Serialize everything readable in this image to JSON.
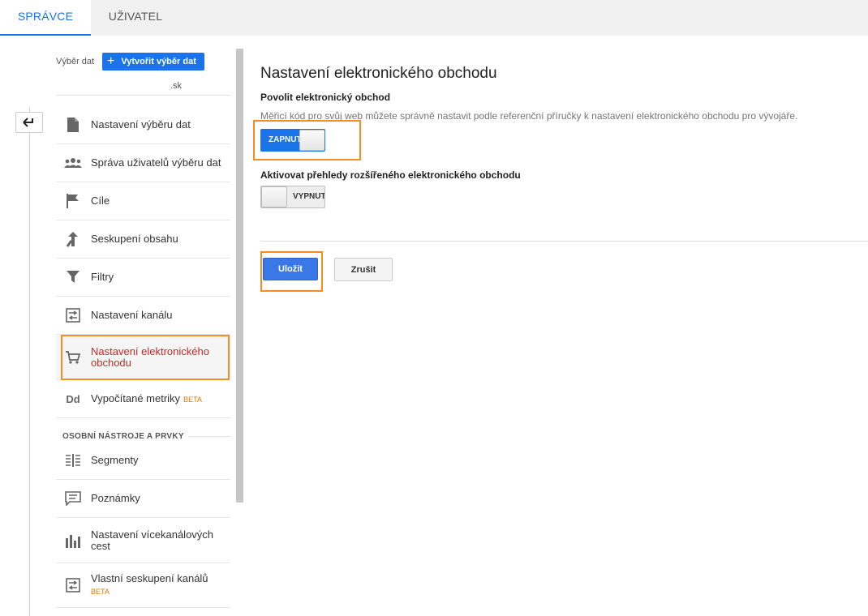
{
  "tabs": [
    {
      "label": "SPRÁVCE"
    },
    {
      "label": "UŽIVATEL"
    }
  ],
  "property": {
    "label": "Výběr dat",
    "create_button": "Vytvořit výběr dat",
    "domain": ".sk"
  },
  "sidebar": {
    "items": [
      {
        "label": "Nastavení výběru dat",
        "icon": "document-icon"
      },
      {
        "label": "Správa uživatelů výběru dat",
        "icon": "users-icon"
      },
      {
        "label": "Cíle",
        "icon": "flag-icon"
      },
      {
        "label": "Seskupení obsahu",
        "icon": "merge-icon"
      },
      {
        "label": "Filtry",
        "icon": "filter-icon"
      },
      {
        "label": "Nastavení kanálu",
        "icon": "channel-icon"
      },
      {
        "label": "Nastavení elektronického obchodu",
        "icon": "cart-icon",
        "active": true
      },
      {
        "label": "Vypočítané metriky",
        "badge": "BETA",
        "icon": "dd-icon"
      }
    ],
    "section_title": "OSOBNÍ NÁSTROJE A PRVKY",
    "personal_items": [
      {
        "label": "Segmenty",
        "icon": "segments-icon"
      },
      {
        "label": "Poznámky",
        "icon": "annotation-icon"
      },
      {
        "label": "Nastavení vícekanálových cest",
        "icon": "bar-chart-icon"
      },
      {
        "label": "Vlastní seskupení kanálů",
        "badge": "BETA",
        "icon": "channel-icon"
      }
    ]
  },
  "main": {
    "title": "Nastavení elektronického obchodu",
    "enable_title": "Povolit elektronický obchod",
    "enable_help": "Měřicí kód pro svůj web můžete správně nastavit podle referenční příručky k nastavení elektronického obchodu pro vývojáře.",
    "enable_toggle": "ZAPNUTO",
    "enhanced_title": "Aktivovat přehledy rozšířeného elektronického obchodu",
    "enhanced_toggle": "VYPNUTO",
    "save_label": "Uložit",
    "cancel_label": "Zrušit"
  },
  "colors": {
    "accent": "#1a73e8",
    "highlight": "#f68d1e",
    "active_text": "#c62828",
    "beta": "#e37400"
  }
}
